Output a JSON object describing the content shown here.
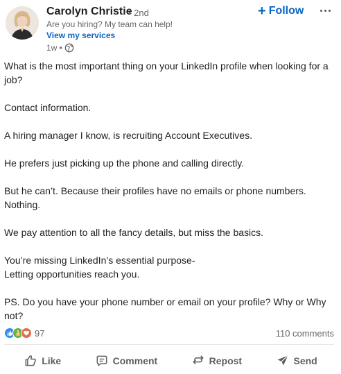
{
  "author": {
    "name": "Carolyn Christie",
    "degree": "• 2nd",
    "headline": "Are you hiring? My team can help!",
    "services_link": "View my services",
    "time": "1w •"
  },
  "header_actions": {
    "follow_label": "Follow",
    "follow_icon": "plus-icon",
    "more_icon": "more-icon"
  },
  "post": {
    "paragraphs": [
      "What is the most important thing on your LinkedIn profile when looking for a job?",
      "Contact information.",
      "A hiring manager I know, is recruiting Account Executives.",
      "He prefers just picking up the phone and calling directly.",
      "But he can’t. Because their profiles have no emails or phone numbers.",
      "Nothing.",
      "We pay attention to all the fancy details, but miss the basics.",
      "You’re missing LinkedIn’s essential purpose-",
      "Letting opportunities reach you.",
      "PS. Do you have your phone number or email on your profile? Why or Why not?"
    ]
  },
  "social": {
    "reaction_count": "97",
    "comments": "110 comments",
    "reaction_icons": [
      "like-icon",
      "celebrate-icon",
      "love-icon"
    ]
  },
  "actions": {
    "like": "Like",
    "comment": "Comment",
    "repost": "Repost",
    "send": "Send"
  },
  "colors": {
    "accent": "#0a66c2",
    "like": "#378fe9",
    "celebrate": "#6dae4f",
    "love": "#df704d"
  }
}
